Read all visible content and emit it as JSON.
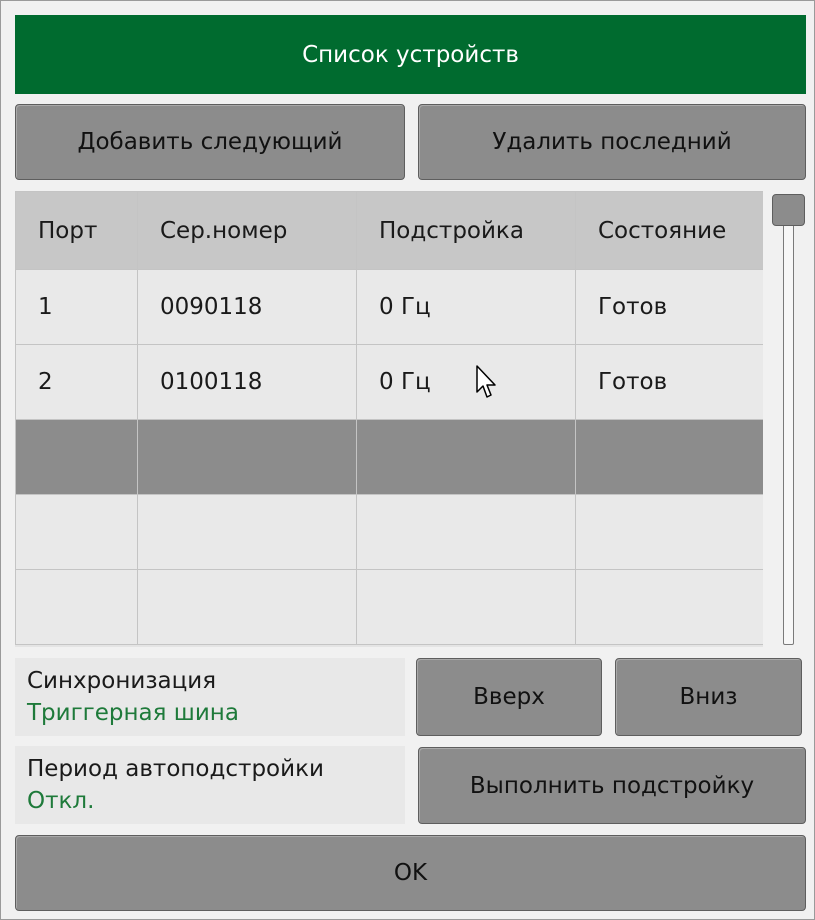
{
  "dialog": {
    "title": "Список устройств",
    "add_next_label": "Добавить следующий",
    "delete_last_label": "Удалить последний"
  },
  "table": {
    "headers": [
      "Порт",
      "Сер.номер",
      "Подстройка",
      "Состояние"
    ],
    "rows": [
      [
        "1",
        "0090118",
        "0 Гц",
        "Готов"
      ],
      [
        "2",
        "0100118",
        "0 Гц",
        "Готов"
      ],
      [
        "",
        "",
        "",
        ""
      ],
      [
        "",
        "",
        "",
        ""
      ],
      [
        "",
        "",
        "",
        ""
      ]
    ],
    "selected_row": 2
  },
  "sync": {
    "label": "Синхронизация",
    "value": "Триггерная шина"
  },
  "period": {
    "label": "Период автоподстройки",
    "value": "Откл."
  },
  "buttons": {
    "up": "Вверх",
    "down": "Вниз",
    "tune": "Выполнить подстройку",
    "ok": "OK"
  },
  "icons": {
    "cursor": "mouse-pointer-icon"
  },
  "colors": {
    "title_bg": "#006b2f",
    "value_text": "#1e7a3a",
    "button": "#8c8c8c",
    "selected_row": "#8c8c8c"
  }
}
